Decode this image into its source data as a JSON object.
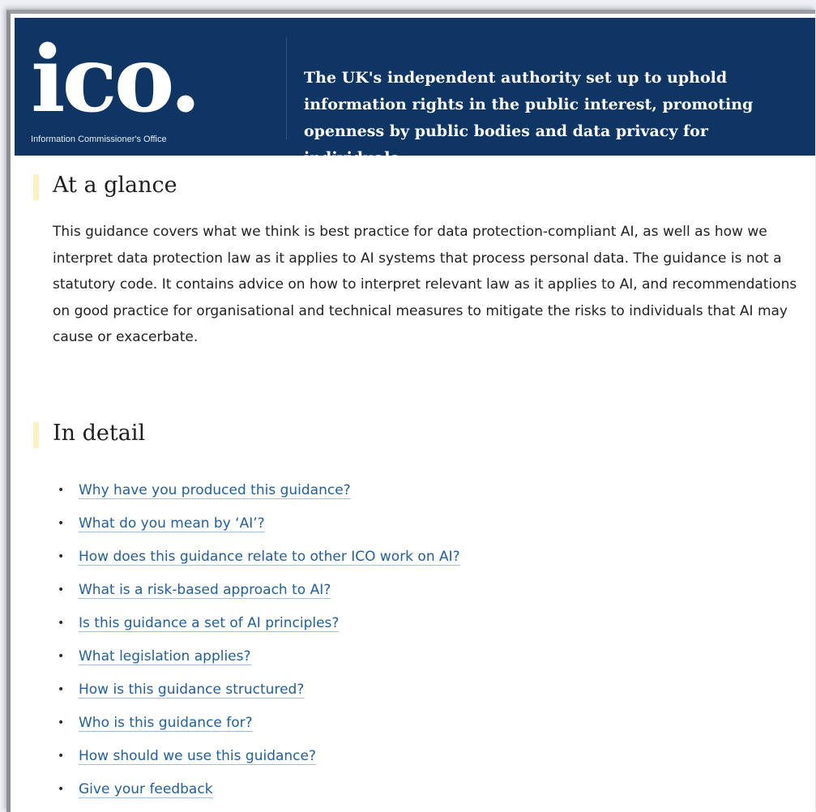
{
  "header": {
    "logo_text": "ico.",
    "logo_subtitle": "Information Commissioner's Office",
    "tagline": "The UK's independent authority set up to uphold information rights in the public interest, promoting openness by public bodies and data privacy for individuals."
  },
  "glance": {
    "heading": "At a glance",
    "body": "This guidance covers what we think is best practice for data protection-compliant AI, as well as how we interpret data protection law as it applies to AI systems that process personal data. The guidance is not a statutory code. It contains advice on how to interpret relevant law as it applies to AI, and recommendations on good practice for organisational and technical measures to mitigate the risks to individuals that AI may cause or exacerbate."
  },
  "detail": {
    "heading": "In detail",
    "bullet": "•",
    "links": [
      "Why have you produced this guidance?",
      "What do you mean by ‘AI’?",
      "How does this guidance relate to other ICO work on AI?",
      "What is a risk-based approach to AI?",
      "Is this guidance a set of AI principles?",
      "What legislation applies?",
      "How is this guidance structured?",
      "Who is this guidance for?",
      "How should we use this guidance?",
      "Give your feedback"
    ]
  },
  "colors": {
    "header_bg": "#0e3563",
    "link": "#1f5fa2",
    "heading_accent": "#fdf0c0"
  }
}
